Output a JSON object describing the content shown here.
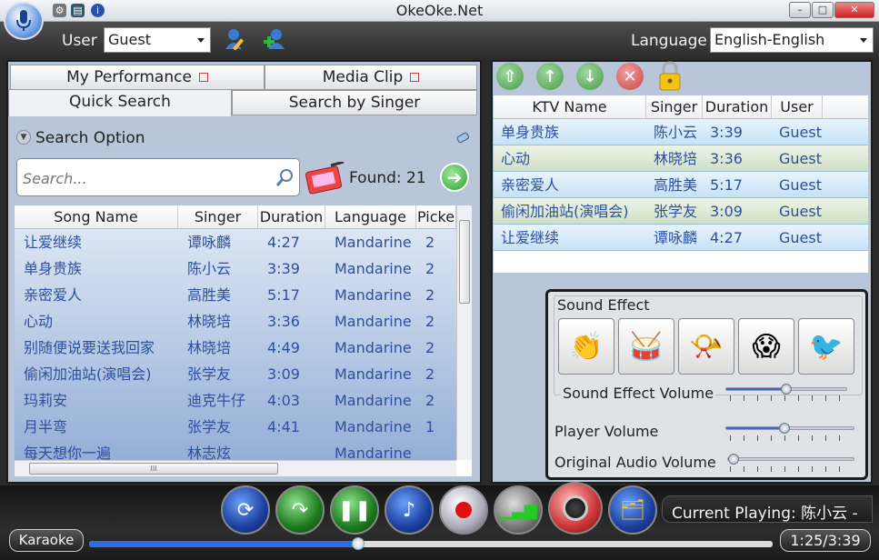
{
  "window": {
    "title": "OkeOke.Net",
    "minimize": "–",
    "maximize": "□",
    "close": "✕"
  },
  "topbar": {
    "user_label": "User",
    "user_value": "Guest",
    "language_label": "Language",
    "language_value": "English-English"
  },
  "left": {
    "tabs": [
      {
        "label": "My Performance"
      },
      {
        "label": "Media Clip"
      },
      {
        "label": "Quick Search"
      },
      {
        "label": "Search by Singer"
      }
    ],
    "search_option_label": "Search Option",
    "search_placeholder": "Search...",
    "found_label": "Found:",
    "found_count": "21",
    "columns": [
      "Song Name",
      "Singer",
      "Duration",
      "Language",
      "Picke"
    ],
    "rows": [
      {
        "song": "让爱继续",
        "singer": "谭咏麟",
        "duration": "4:27",
        "language": "Mandarine",
        "picked": "2"
      },
      {
        "song": "单身贵族",
        "singer": "陈小云",
        "duration": "3:39",
        "language": "Mandarine",
        "picked": "2"
      },
      {
        "song": "亲密爱人",
        "singer": "高胜美",
        "duration": "5:17",
        "language": "Mandarine",
        "picked": "2"
      },
      {
        "song": "心动",
        "singer": "林晓培",
        "duration": "3:36",
        "language": "Mandarine",
        "picked": "2"
      },
      {
        "song": "别随便说要送我回家",
        "singer": "林晓培",
        "duration": "4:49",
        "language": "Mandarine",
        "picked": "2"
      },
      {
        "song": "偷闲加油站(演唱会)",
        "singer": "张学友",
        "duration": "3:09",
        "language": "Mandarine",
        "picked": "2"
      },
      {
        "song": "玛莉安",
        "singer": "迪克牛仔",
        "duration": "4:03",
        "language": "Mandarine",
        "picked": "2"
      },
      {
        "song": "月半弯",
        "singer": "张学友",
        "duration": "4:41",
        "language": "Mandarine",
        "picked": "1"
      },
      {
        "song": "每天想你一遍",
        "singer": "林志炫",
        "duration": "",
        "language": "Mandarine",
        "picked": ""
      }
    ],
    "hscroll_grip": "III"
  },
  "right": {
    "columns": [
      "KTV Name",
      "Singer",
      "Duration",
      "User"
    ],
    "rows": [
      {
        "name": "单身贵族",
        "singer": "陈小云",
        "duration": "3:39",
        "user": "Guest"
      },
      {
        "name": "心动",
        "singer": "林晓培",
        "duration": "3:36",
        "user": "Guest"
      },
      {
        "name": "亲密爱人",
        "singer": "高胜美",
        "duration": "5:17",
        "user": "Guest"
      },
      {
        "name": "偷闲加油站(演唱会)",
        "singer": "张学友",
        "duration": "3:09",
        "user": "Guest"
      },
      {
        "name": "让爱继续",
        "singer": "谭咏麟",
        "duration": "4:27",
        "user": "Guest"
      }
    ]
  },
  "sound": {
    "title": "Sound Effect",
    "effect_volume_label": "Sound Effect Volume",
    "effect_volume": 0.5,
    "player_volume_label": "Player Volume",
    "player_volume": 0.45,
    "original_volume_label": "Original Audio Volume",
    "original_volume": 0.0
  },
  "player": {
    "mode_label": "Karaoke",
    "now_playing": "Current Playing: 陈小云 -",
    "time": "1:25/3:39",
    "progress": 0.39
  },
  "colors": {
    "accent": "#3a67d8",
    "row_blue": "#d8ebf7",
    "row_green": "#dce9d6"
  }
}
